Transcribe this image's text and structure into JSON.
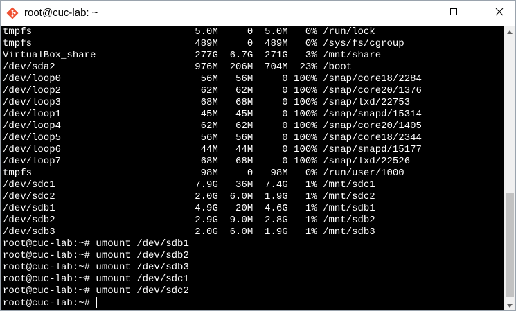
{
  "window": {
    "title": "root@cuc-lab: ~",
    "app_icon": "git-diamond-icon",
    "controls": {
      "minimize": "minimize-icon",
      "maximize": "maximize-icon",
      "close": "close-icon"
    }
  },
  "terminal": {
    "lines": [
      "tmpfs                            5.0M     0  5.0M   0% /run/lock",
      "tmpfs                            489M     0  489M   0% /sys/fs/cgroup",
      "VirtualBox_share                 277G  6.7G  271G   3% /mnt/share",
      "/dev/sda2                        976M  206M  704M  23% /boot",
      "/dev/loop0                        56M   56M     0 100% /snap/core18/2284",
      "/dev/loop2                        62M   62M     0 100% /snap/core20/1376",
      "/dev/loop3                        68M   68M     0 100% /snap/lxd/22753",
      "/dev/loop1                        45M   45M     0 100% /snap/snapd/15314",
      "/dev/loop4                        62M   62M     0 100% /snap/core20/1405",
      "/dev/loop5                        56M   56M     0 100% /snap/core18/2344",
      "/dev/loop6                        44M   44M     0 100% /snap/snapd/15177",
      "/dev/loop7                        68M   68M     0 100% /snap/lxd/22526",
      "tmpfs                             98M     0   98M   0% /run/user/1000",
      "/dev/sdc1                        7.9G   36M  7.4G   1% /mnt/sdc1",
      "/dev/sdc2                        2.0G  6.0M  1.9G   1% /mnt/sdc2",
      "/dev/sdb1                        4.9G   20M  4.6G   1% /mnt/sdb1",
      "/dev/sdb2                        2.9G  9.0M  2.8G   1% /mnt/sdb2",
      "/dev/sdb3                        2.0G  6.0M  1.9G   1% /mnt/sdb3",
      "root@cuc-lab:~# umount /dev/sdb1",
      "root@cuc-lab:~# umount /dev/sdb2",
      "root@cuc-lab:~# umount /dev/sdb3",
      "root@cuc-lab:~# umount /dev/sdc1",
      "root@cuc-lab:~# umount /dev/sdc2"
    ],
    "prompt": "root@cuc-lab:~# ",
    "input_value": ""
  },
  "colors": {
    "terminal_bg": "#000000",
    "terminal_fg": "#ffffff",
    "titlebar_bg": "#ffffff",
    "scrollbar_track": "#f0f0f0",
    "scrollbar_thumb": "#c2c2c2"
  }
}
